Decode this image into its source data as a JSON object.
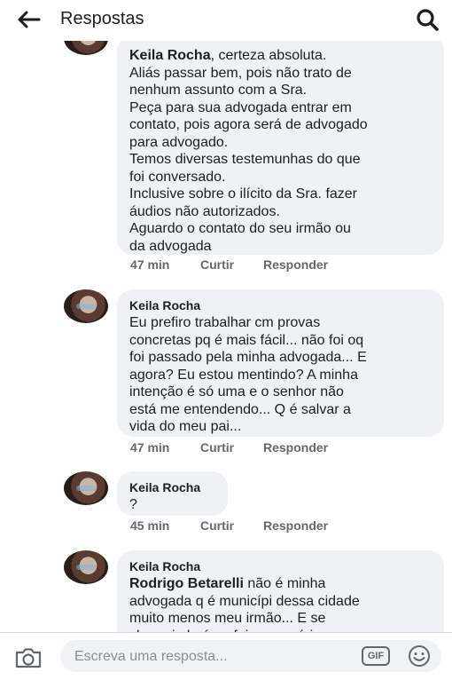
{
  "header": {
    "title": "Respostas",
    "back_icon": "arrow-left-icon",
    "search_icon": "search-icon"
  },
  "comments": [
    {
      "author": "Keila Rocha",
      "lead": ", certeza absoluta.",
      "text": "Aliás passar bem, pois não trato de\nnenhum assunto com a Sra.\nPeça para sua advogada entrar em\ncontato, pois agora será de advogado\npara advogado.\nTemos diversas testemunhas do que\nfoi conversado.\nInclusive sobre o ilícito da Sra. fazer\náudios não autorizados.\nAguardo o contato do seu irmão ou\nda advogada",
      "time": "47 min",
      "like": "Curtir",
      "reply": "Responder"
    },
    {
      "author": "Keila Rocha",
      "text": "Eu prefiro trabalhar cm provas\nconcretas pq é mais fácil... não foi oq\nfoi passado pela minha advogada... E\nagora? Eu estou mentindo? A minha\nintenção é só uma e o senhor não\nestá me entendendo... Q é salvar a\nvida do meu pai...",
      "time": "47 min",
      "like": "Curtir",
      "reply": "Responder"
    },
    {
      "author": "Keila Rocha",
      "text": "?",
      "time": "45 min",
      "like": "Curtir",
      "reply": "Responder"
    },
    {
      "author": "Keila Rocha",
      "mention": "Rodrigo Betarelli",
      "text": " não é minha\nadvogada q é municípi dessa cidade\nmuito menos meu irmão... E se\nchamei ela é pq foi necessário... o"
    }
  ],
  "footer": {
    "placeholder": "Escreva uma resposta...",
    "gif_label": "GIF",
    "camera_icon": "camera-icon",
    "emoji_icon": "smiley-icon"
  },
  "colors": {
    "bubble": "#eff1f4",
    "meta_text": "#65676b"
  }
}
